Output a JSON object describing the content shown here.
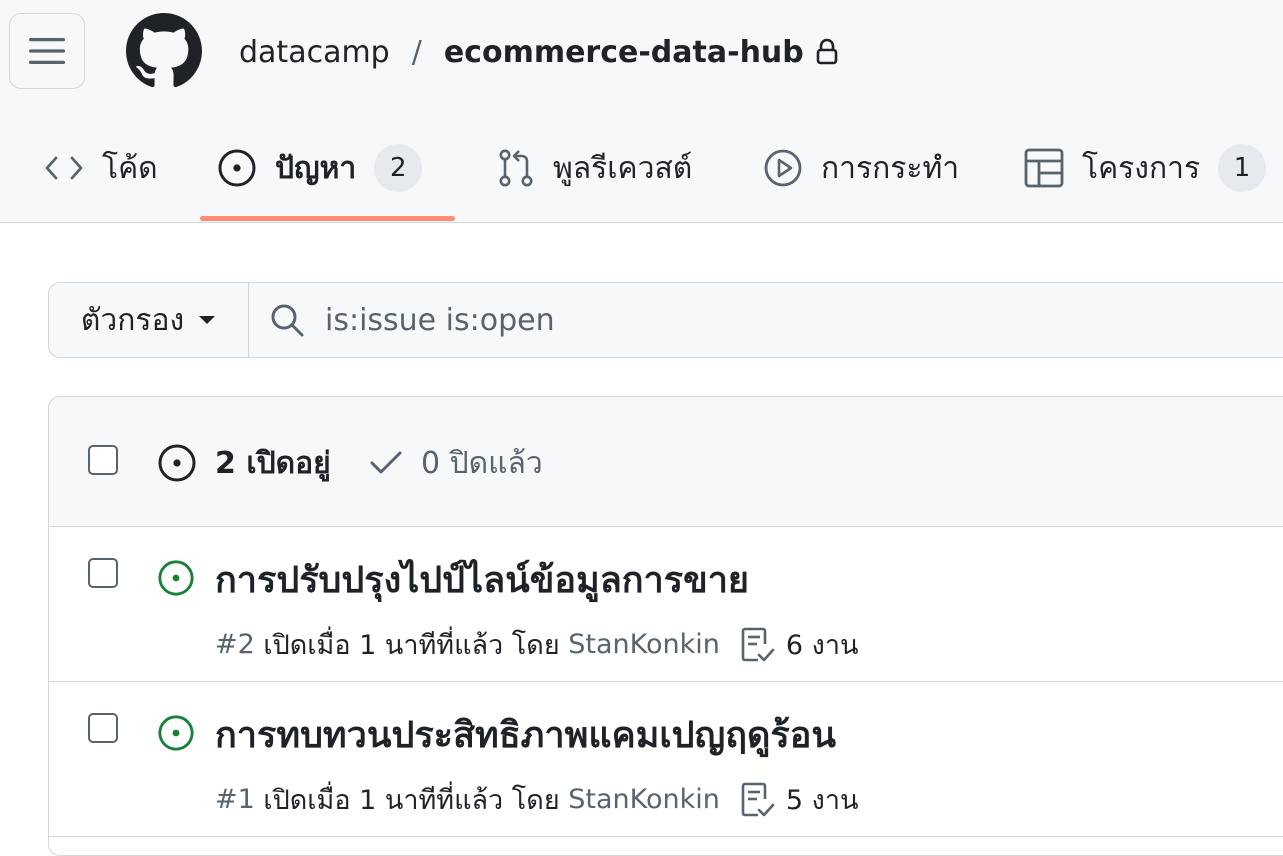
{
  "header": {
    "owner": "datacamp",
    "separator": "/",
    "repo": "ecommerce-data-hub"
  },
  "tabs": [
    {
      "label": "โค้ด",
      "icon": "code-icon"
    },
    {
      "label": "ปัญหา",
      "icon": "issue-opened-icon",
      "count": "2",
      "active": true
    },
    {
      "label": "พูลรีเควสต์",
      "icon": "git-pull-request-icon"
    },
    {
      "label": "การกระทำ",
      "icon": "play-icon"
    },
    {
      "label": "โครงการ",
      "icon": "table-icon",
      "count": "1"
    }
  ],
  "filter": {
    "button_label": "ตัวกรอง",
    "query": "is:issue is:open"
  },
  "issues_header": {
    "open_label": "2 เปิดอยู่",
    "closed_label": "0 ปิดแล้ว"
  },
  "issues": [
    {
      "title": "การปรับปรุงไปป์ไลน์ข้อมูลการขาย",
      "number": "#2",
      "opened_text": "เปิดเมื่อ 1 นาทีที่แล้ว โดย",
      "author": "StanKonkin",
      "tasks": "6 งาน"
    },
    {
      "title": "การทบทวนประสิทธิภาพแคมเปญฤดูร้อน",
      "number": "#1",
      "opened_text": "เปิดเมื่อ 1 นาทีที่แล้ว โดย",
      "author": "StanKonkin",
      "tasks": "5 งาน"
    }
  ],
  "colors": {
    "open_green": "#1a7f37",
    "tab_underline": "#fd8c73",
    "muted": "#59636e",
    "border": "#d0d7de"
  }
}
